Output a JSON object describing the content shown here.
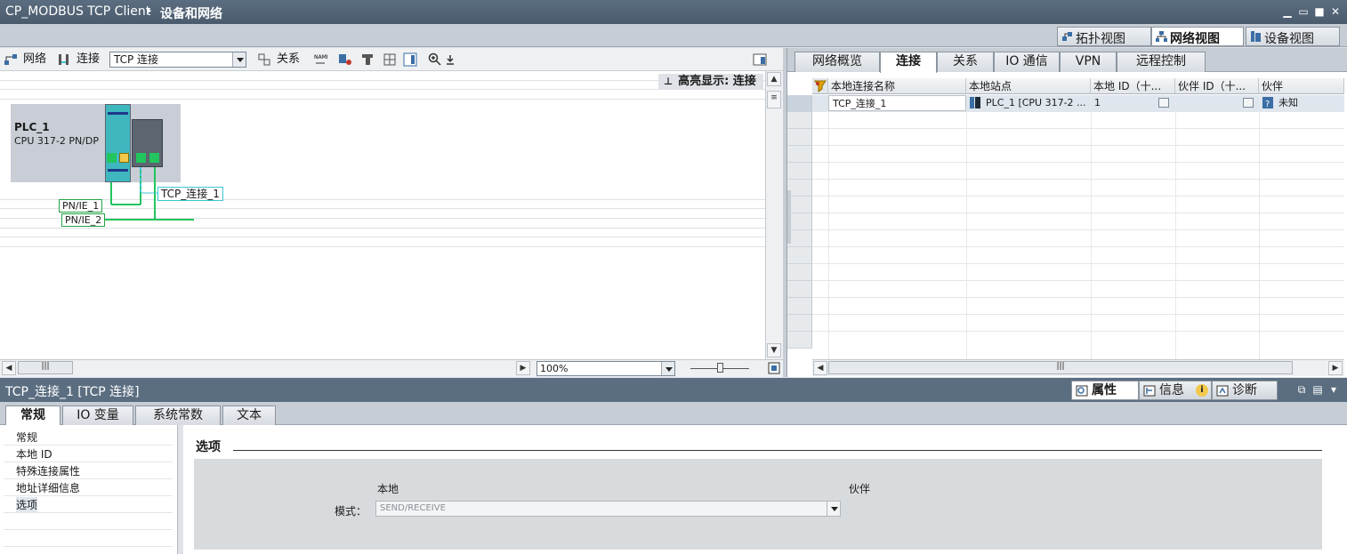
{
  "window": {
    "project": "CP_MODBUS TCP Client",
    "section": "设备和网络"
  },
  "view_tabs": [
    "拓扑视图",
    "网络视图",
    "设备视图"
  ],
  "left_toolbar": {
    "network_label": "网络",
    "connection_label": "连接",
    "connection_type": "TCP 连接",
    "relation_label": "关系"
  },
  "canvas": {
    "highlight_label": "高亮显示: 连接",
    "plc_name": "PLC_1",
    "plc_cpu": "CPU 317-2 PN/DP",
    "tcp_connection": "TCP_连接_1",
    "subnet1": "PN/IE_1",
    "subnet2": "PN/IE_2",
    "zoom": "100%"
  },
  "right_tabs": [
    "网络概览",
    "连接",
    "关系",
    "IO 通信",
    "VPN",
    "远程控制"
  ],
  "connection_table": {
    "headers": [
      "本地连接名称",
      "本地站点",
      "本地 ID（十...",
      "伙伴 ID（十...",
      "伙伴"
    ],
    "rows": [
      {
        "name": "TCP_连接_1",
        "station": "PLC_1 [CPU 317-2 ...",
        "local_id": "1",
        "partner_id": "",
        "partner": "未知"
      }
    ]
  },
  "inspector": {
    "title": "TCP_连接_1 [TCP 连接]",
    "tabs": [
      "属性",
      "信息",
      "诊断"
    ],
    "subtabs": [
      "常规",
      "IO 变量",
      "系统常数",
      "文本"
    ],
    "nav": [
      "常规",
      "本地 ID",
      "特殊连接属性",
      "地址详细信息",
      "选项"
    ],
    "section_title": "选项",
    "local_label": "本地",
    "partner_label": "伙伴",
    "mode_label": "模式：",
    "mode_value": "SEND/RECEIVE"
  },
  "colors": {
    "titlebar": "#5b6d80",
    "subnet_green": "#22c55e",
    "connection_cyan": "#3cc7d6"
  }
}
